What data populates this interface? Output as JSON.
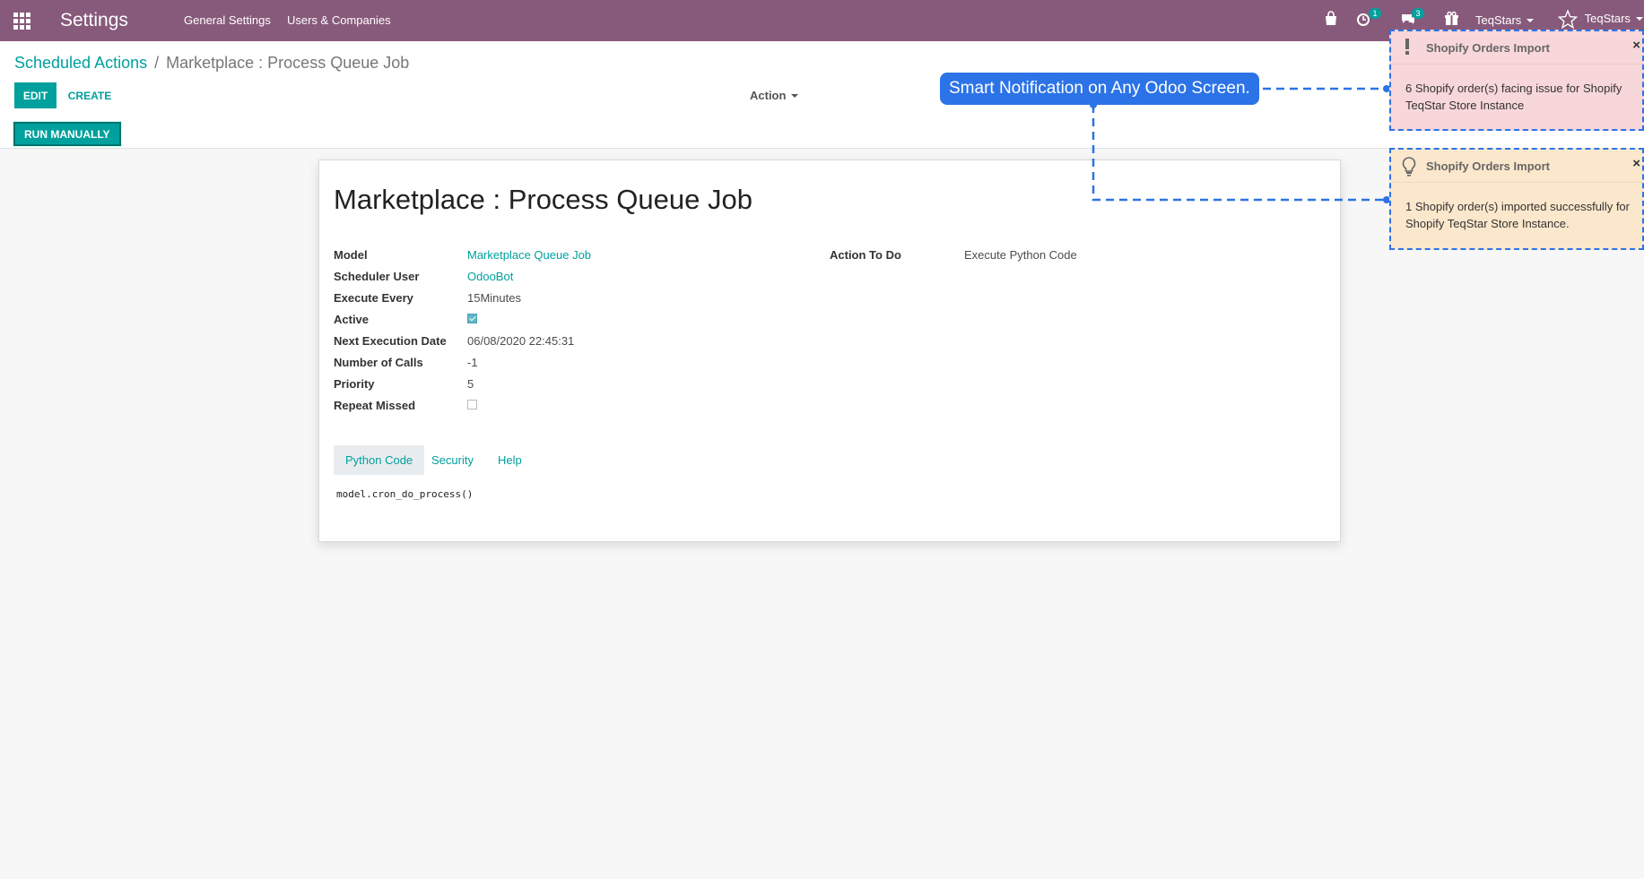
{
  "navbar": {
    "app_title": "Settings",
    "menus": [
      "General Settings",
      "Users & Companies"
    ],
    "activity_count": "1",
    "message_count": "3",
    "company_label": "TeqStars",
    "user_label": "TeqStars",
    "bg_color": "#875a7b"
  },
  "breadcrumb": {
    "parent": "Scheduled Actions",
    "separator": "/",
    "current": "Marketplace : Process Queue Job"
  },
  "buttons": {
    "edit": "EDIT",
    "create": "CREATE",
    "action": "Action",
    "run_manually": "RUN MANUALLY"
  },
  "form": {
    "title": "Marketplace : Process Queue Job",
    "fields": {
      "model": {
        "label": "Model",
        "value": "Marketplace Queue Job"
      },
      "scheduler_user": {
        "label": "Scheduler User",
        "value": "OdooBot"
      },
      "execute_every": {
        "label": "Execute Every",
        "value": "15Minutes"
      },
      "active": {
        "label": "Active",
        "checked": true
      },
      "next_execution": {
        "label": "Next Execution Date",
        "value": "06/08/2020 22:45:31"
      },
      "number_of_calls": {
        "label": "Number of Calls",
        "value": "-1"
      },
      "priority": {
        "label": "Priority",
        "value": "5"
      },
      "repeat_missed": {
        "label": "Repeat Missed",
        "checked": false
      },
      "action_to_do": {
        "label": "Action To Do",
        "value": "Execute Python Code"
      }
    },
    "tabs": [
      "Python Code",
      "Security",
      "Help"
    ],
    "active_tab": "Python Code",
    "code": "model.cron_do_process()"
  },
  "notifications": [
    {
      "type": "warning",
      "icon": "exclamation-icon",
      "title": "Shopify Orders Import",
      "message": "6 Shopify order(s) facing issue for Shopify TeqStar Store Instance",
      "bg_color": "#f8d7da"
    },
    {
      "type": "info",
      "icon": "lightbulb-icon",
      "title": "Shopify Orders Import",
      "message": "1 Shopify order(s) imported successfully for Shopify TeqStar Store Instance.",
      "bg_color": "#fbe7cc"
    }
  ],
  "callout": {
    "text": "Smart Notification on Any Odoo Screen.",
    "color": "#2b73e6"
  },
  "colors": {
    "accent": "#00a09d"
  }
}
